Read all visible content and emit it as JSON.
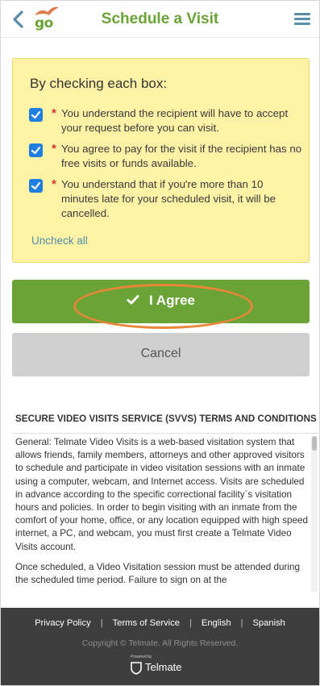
{
  "header": {
    "logo_text": "go",
    "title": "Schedule a Visit",
    "back_icon": "chevron-left-icon",
    "menu_icon": "hamburger-menu-icon",
    "accent": "#6aa336"
  },
  "agreement": {
    "heading": "By checking each box:",
    "required_mark": "*",
    "items": [
      {
        "text": "You understand the recipient will have to accept your request before you can visit.",
        "checked": true
      },
      {
        "text": "You agree to pay for the visit if the recipient has no free visits or funds available.",
        "checked": true
      },
      {
        "text": "You understand that if you're more than 10 minutes late for your scheduled visit, it will be cancelled.",
        "checked": true
      }
    ],
    "uncheck_all": "Uncheck all"
  },
  "actions": {
    "agree_label": "I Agree",
    "cancel_label": "Cancel"
  },
  "terms": {
    "title": "SECURE VIDEO VISITS SERVICE (SVVS) TERMS AND CONDITIONS",
    "paragraphs": [
      "General: Telmate Video Visits is a web-based visitation system that allows friends, family members, attorneys and other approved visitors to schedule and participate in video visitation sessions with an inmate using a computer, webcam, and Internet access. Visits are scheduled in advance according to the specific correctional facility`s visitation hours and policies. In order to begin visiting with an inmate from the comfort of your home, office, or any location equipped with high speed internet, a PC, and webcam, you must first create a Telmate Video Visits account.",
      "Once scheduled, a Video Visitation session must be attended during the scheduled time period. Failure to sign on at the"
    ]
  },
  "footer": {
    "links": [
      "Privacy Policy",
      "Terms of Service",
      "English",
      "Spanish"
    ],
    "copyright": "Copyright © Telmate. All Rights Reserved.",
    "powered_by": "Powered by",
    "brand": "Telmate"
  }
}
